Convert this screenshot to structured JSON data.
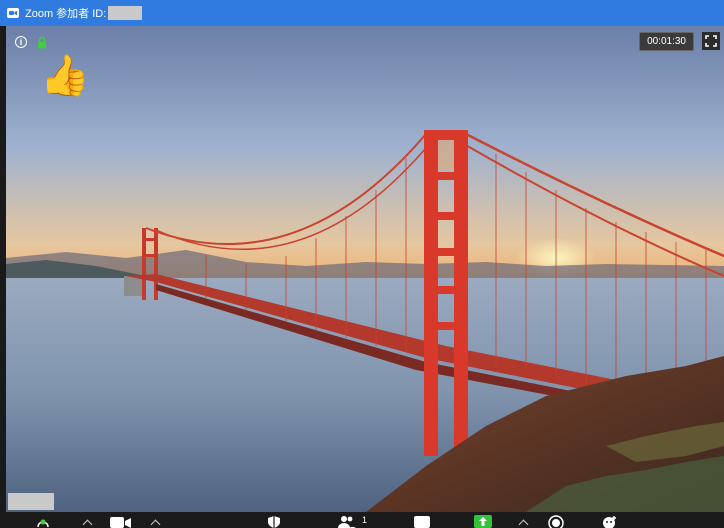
{
  "title": {
    "app_name": "Zoom 参加者 ID:"
  },
  "video": {
    "timer": "00:01:30",
    "reaction": "👍"
  },
  "toolbar": {
    "participants_count": "1",
    "icons": [
      "mute-audio-icon",
      "video-camera-icon",
      "security-shield-icon",
      "participants-icon",
      "chat-icon",
      "share-screen-icon",
      "record-icon",
      "reactions-icon"
    ]
  },
  "colors": {
    "titlebar": "#2f7be0",
    "share_green": "#35c23b",
    "bridge_red": "#d8392b"
  }
}
